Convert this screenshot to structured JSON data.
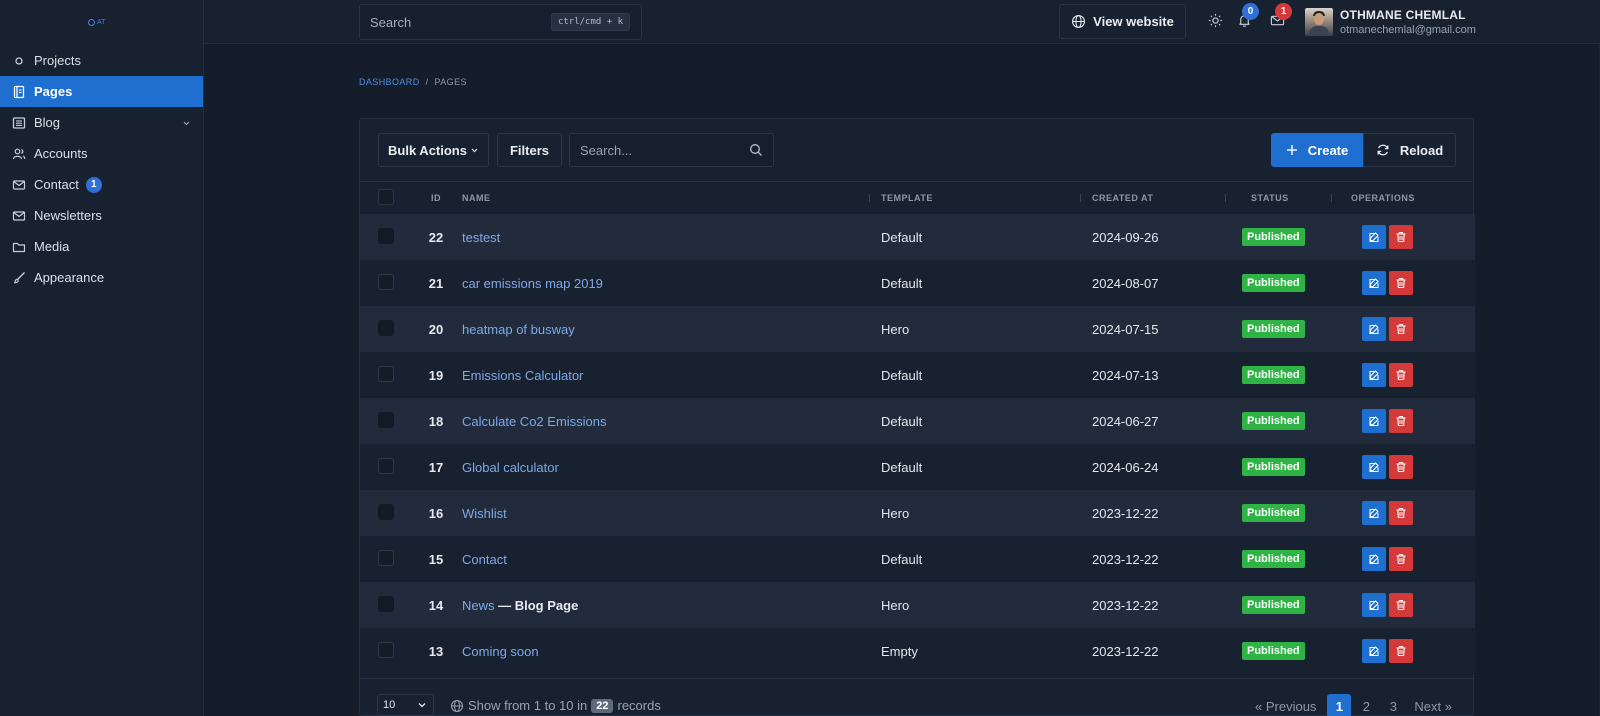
{
  "brand": {
    "logo_text": "AT"
  },
  "sidebar": {
    "items": [
      {
        "label": "Projects",
        "icon": "circle-icon",
        "active": false
      },
      {
        "label": "Pages",
        "icon": "notebook-icon",
        "active": true
      },
      {
        "label": "Blog",
        "icon": "list-icon",
        "active": false,
        "has_children": true
      },
      {
        "label": "Accounts",
        "icon": "users-icon",
        "active": false
      },
      {
        "label": "Contact",
        "icon": "mail-icon",
        "active": false,
        "badge": "1"
      },
      {
        "label": "Newsletters",
        "icon": "mail-icon",
        "active": false
      },
      {
        "label": "Media",
        "icon": "folder-icon",
        "active": false
      },
      {
        "label": "Appearance",
        "icon": "brush-icon",
        "active": false
      }
    ]
  },
  "header": {
    "search_placeholder": "Search",
    "search_shortcut": "ctrl/cmd + k",
    "view_website_label": "View website",
    "notifications_count": "0",
    "messages_count": "1",
    "user_name": "OTHMANE CHEMLAL",
    "user_email": "otmanechemlal@gmail.com"
  },
  "breadcrumb": {
    "root": "DASHBOARD",
    "separator": "/",
    "current": "PAGES"
  },
  "toolbar": {
    "bulk_actions_label": "Bulk Actions",
    "filters_label": "Filters",
    "search_placeholder": "Search...",
    "create_label": "Create",
    "reload_label": "Reload"
  },
  "table": {
    "columns": {
      "id": "ID",
      "name": "NAME",
      "template": "TEMPLATE",
      "created_at": "CREATED AT",
      "status": "STATUS",
      "operations": "OPERATIONS"
    },
    "rows": [
      {
        "id": "22",
        "name": "testest",
        "suffix": "",
        "template": "Default",
        "created_at": "2024-09-26",
        "status": "Published"
      },
      {
        "id": "21",
        "name": "car emissions map 2019",
        "suffix": "",
        "template": "Default",
        "created_at": "2024-08-07",
        "status": "Published"
      },
      {
        "id": "20",
        "name": "heatmap of busway",
        "suffix": "",
        "template": "Hero",
        "created_at": "2024-07-15",
        "status": "Published"
      },
      {
        "id": "19",
        "name": "Emissions Calculator",
        "suffix": "",
        "template": "Default",
        "created_at": "2024-07-13",
        "status": "Published"
      },
      {
        "id": "18",
        "name": "Calculate Co2 Emissions",
        "suffix": "",
        "template": "Default",
        "created_at": "2024-06-27",
        "status": "Published"
      },
      {
        "id": "17",
        "name": "Global calculator",
        "suffix": "",
        "template": "Default",
        "created_at": "2024-06-24",
        "status": "Published"
      },
      {
        "id": "16",
        "name": "Wishlist",
        "suffix": "",
        "template": "Hero",
        "created_at": "2023-12-22",
        "status": "Published"
      },
      {
        "id": "15",
        "name": "Contact",
        "suffix": "",
        "template": "Default",
        "created_at": "2023-12-22",
        "status": "Published"
      },
      {
        "id": "14",
        "name": "News",
        "suffix": " — Blog Page",
        "template": "Hero",
        "created_at": "2023-12-22",
        "status": "Published"
      },
      {
        "id": "13",
        "name": "Coming soon",
        "suffix": "",
        "template": "Empty",
        "created_at": "2023-12-22",
        "status": "Published"
      }
    ]
  },
  "footer": {
    "per_page": "10",
    "info_prefix": "Show from 1 to 10 in",
    "total_records": "22",
    "info_suffix": "records",
    "previous_label": "« Previous",
    "pages": [
      "1",
      "2",
      "3"
    ],
    "current_page": "1",
    "next_label": "Next »"
  },
  "colors": {
    "accent": "#1f6fd1",
    "published": "#2fb344",
    "danger": "#d63939",
    "background": "#151d2b",
    "panel": "#182130"
  }
}
